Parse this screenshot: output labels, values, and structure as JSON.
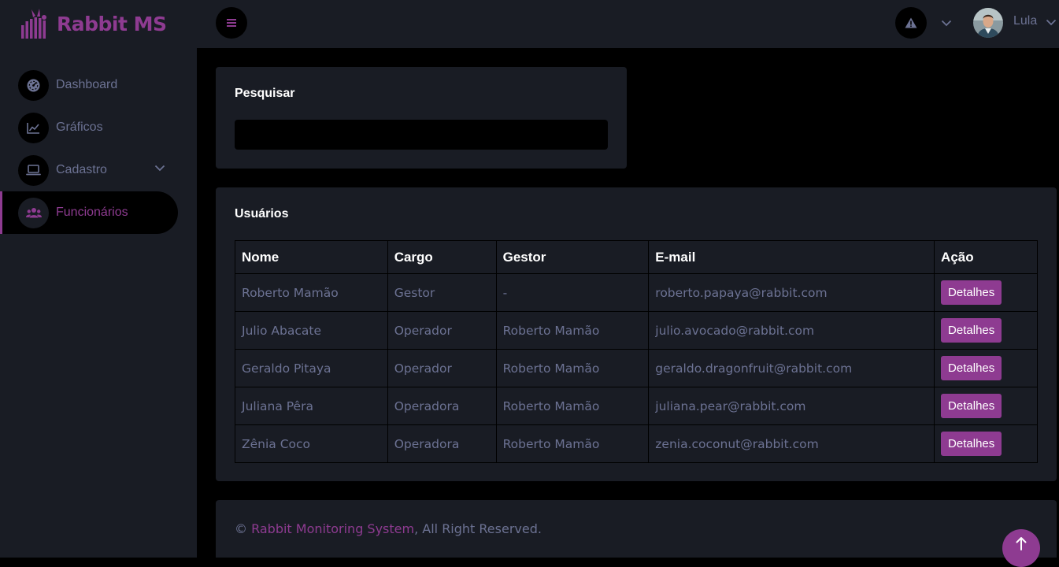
{
  "brand": {
    "name": "Rabbit MS",
    "logo_icon": "rabbit-logo-icon",
    "accent": "#8e3b91"
  },
  "nav": {
    "items": [
      {
        "label": "Dashboard",
        "icon": "speedometer-icon"
      },
      {
        "label": "Gráficos",
        "icon": "line-chart-icon"
      },
      {
        "label": "Cadastro",
        "icon": "laptop-icon",
        "has_submenu": true
      },
      {
        "label": "Funcionários",
        "icon": "users-icon",
        "active": true
      }
    ]
  },
  "topbar": {
    "menu_icon": "hamburger-icon",
    "alert_icon": "warning-icon",
    "user_name": "Lula"
  },
  "search": {
    "title": "Pesquisar",
    "value": "",
    "placeholder": ""
  },
  "users": {
    "title": "Usuários",
    "columns": [
      "Nome",
      "Cargo",
      "Gestor",
      "E-mail",
      "Ação"
    ],
    "rows": [
      {
        "nome": "Roberto Mamão",
        "cargo": "Gestor",
        "gestor": "-",
        "email": "roberto.papaya@rabbit.com",
        "acao": "Detalhes"
      },
      {
        "nome": "Julio Abacate",
        "cargo": "Operador",
        "gestor": "Roberto Mamão",
        "email": "julio.avocado@rabbit.com",
        "acao": "Detalhes"
      },
      {
        "nome": "Geraldo Pitaya",
        "cargo": "Operador",
        "gestor": "Roberto Mamão",
        "email": "geraldo.dragonfruit@rabbit.com",
        "acao": "Detalhes"
      },
      {
        "nome": "Juliana Pêra",
        "cargo": "Operadora",
        "gestor": "Roberto Mamão",
        "email": "juliana.pear@rabbit.com",
        "acao": "Detalhes"
      },
      {
        "nome": "Zênia Coco",
        "cargo": "Operadora",
        "gestor": "Roberto Mamão",
        "email": "zenia.coconut@rabbit.com",
        "acao": "Detalhes"
      }
    ]
  },
  "footer": {
    "prefix": "© ",
    "link": "Rabbit Monitoring System",
    "suffix": ", All Right Reserved."
  },
  "scroll_top_icon": "arrow-up-icon"
}
